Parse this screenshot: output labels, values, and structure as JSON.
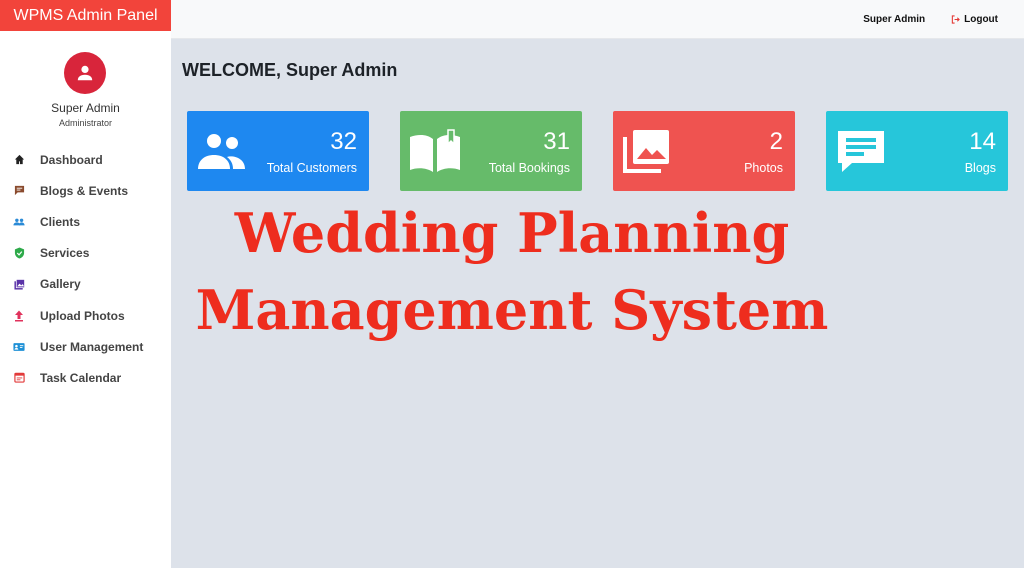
{
  "brand": {
    "title": "WPMS Admin Panel",
    "color": "#f2443b"
  },
  "topbar": {
    "user": "Super Admin",
    "logout_label": "Logout"
  },
  "profile": {
    "name": "Super Admin",
    "role": "Administrator"
  },
  "sidebar": {
    "items": [
      {
        "label": "Dashboard",
        "icon": "home-icon",
        "color": "#222222"
      },
      {
        "label": "Blogs & Events",
        "icon": "comment-icon",
        "color": "#8a4b2e"
      },
      {
        "label": "Clients",
        "icon": "users-icon",
        "color": "#2a8ad6"
      },
      {
        "label": "Services",
        "icon": "shield-check-icon",
        "color": "#2eaa4a"
      },
      {
        "label": "Gallery",
        "icon": "gallery-icon",
        "color": "#5a33a8"
      },
      {
        "label": "Upload Photos",
        "icon": "upload-icon",
        "color": "#e0325c"
      },
      {
        "label": "User Management",
        "icon": "id-card-icon",
        "color": "#1e90d6"
      },
      {
        "label": "Task Calendar",
        "icon": "calendar-icon",
        "color": "#e23b3b"
      }
    ]
  },
  "main": {
    "welcome": "WELCOME, Super Admin"
  },
  "cards": [
    {
      "value": "32",
      "label": "Total Customers",
      "color": "#1e88f0",
      "icon": "users-icon"
    },
    {
      "value": "31",
      "label": "Total Bookings",
      "color": "#66bb6a",
      "icon": "book-open-icon"
    },
    {
      "value": "2",
      "label": "Photos",
      "color": "#ef5350",
      "icon": "photos-icon"
    },
    {
      "value": "14",
      "label": "Blogs",
      "color": "#26c6da",
      "icon": "message-icon"
    }
  ],
  "overlay": {
    "line1": "Wedding Planning",
    "line2": "Management System",
    "color": "#ee2d1e"
  }
}
